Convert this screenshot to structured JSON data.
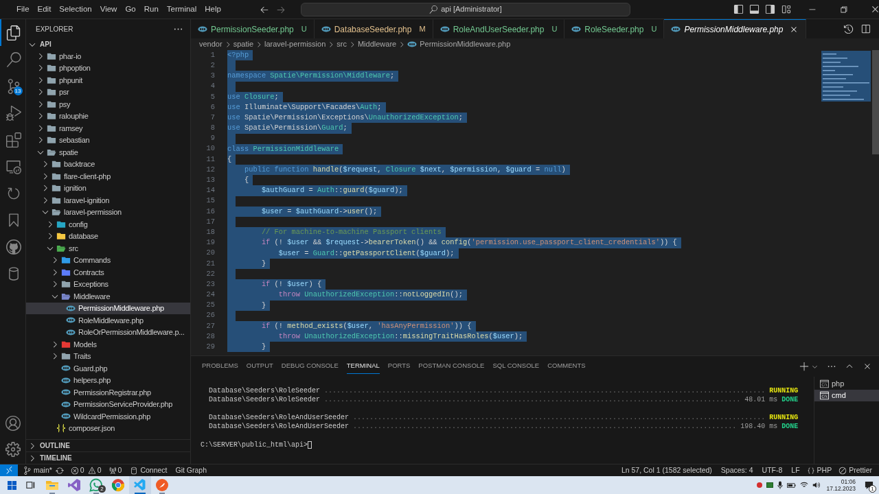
{
  "title_bar": {
    "menu": [
      "File",
      "Edit",
      "Selection",
      "View",
      "Go",
      "Run",
      "Terminal",
      "Help"
    ],
    "command_center": "api [Administrator]"
  },
  "activity_bar": {
    "items": [
      {
        "selected": true
      },
      {
        "selected": false
      },
      {
        "selected": false,
        "badge": "13"
      },
      {
        "selected": false
      },
      {
        "selected": false
      },
      {
        "selected": false
      },
      {
        "selected": false
      },
      {
        "selected": false
      },
      {
        "selected": false
      },
      {
        "selected": false
      }
    ]
  },
  "explorer": {
    "title": "EXPLORER",
    "section": {
      "label": "API",
      "expanded": true
    },
    "tree": [
      {
        "label": "phar-io",
        "kind": "folder",
        "expanded": false,
        "selected": false,
        "color": "#90a4ae"
      },
      {
        "label": "phpoption",
        "kind": "folder",
        "expanded": false,
        "selected": false,
        "color": "#90a4ae"
      },
      {
        "label": "phpunit",
        "kind": "folder",
        "expanded": false,
        "selected": false,
        "color": "#90a4ae"
      },
      {
        "label": "psr",
        "kind": "folder",
        "expanded": false,
        "selected": false,
        "color": "#90a4ae"
      },
      {
        "label": "psy",
        "kind": "folder",
        "expanded": false,
        "selected": false,
        "color": "#90a4ae"
      },
      {
        "label": "ralouphie",
        "kind": "folder",
        "expanded": false,
        "selected": false,
        "color": "#90a4ae"
      },
      {
        "label": "ramsey",
        "kind": "folder",
        "expanded": false,
        "selected": false,
        "color": "#90a4ae"
      },
      {
        "label": "sebastian",
        "kind": "folder",
        "expanded": false,
        "selected": false,
        "color": "#90a4ae"
      },
      {
        "label": "spatie",
        "kind": "folder",
        "expanded": true,
        "selected": false,
        "color": "#90a4ae",
        "children": [
          {
            "label": "backtrace",
            "kind": "folder",
            "expanded": false,
            "selected": false,
            "color": "#90a4ae"
          },
          {
            "label": "flare-client-php",
            "kind": "folder",
            "expanded": false,
            "selected": false,
            "color": "#90a4ae"
          },
          {
            "label": "ignition",
            "kind": "folder",
            "expanded": false,
            "selected": false,
            "color": "#90a4ae"
          },
          {
            "label": "laravel-ignition",
            "kind": "folder",
            "expanded": false,
            "selected": false,
            "color": "#90a4ae"
          },
          {
            "label": "laravel-permission",
            "kind": "folder",
            "expanded": true,
            "selected": false,
            "color": "#90a4ae",
            "children": [
              {
                "label": "config",
                "kind": "folder",
                "expanded": false,
                "selected": false,
                "color": "#26a6c4"
              },
              {
                "label": "database",
                "kind": "folder",
                "expanded": false,
                "selected": false,
                "color": "#f5c842"
              },
              {
                "label": "src",
                "kind": "folder",
                "expanded": true,
                "selected": false,
                "color": "#4caf50",
                "children": [
                  {
                    "label": "Commands",
                    "kind": "folder",
                    "expanded": false,
                    "selected": false,
                    "color": "#2f9be8"
                  },
                  {
                    "label": "Contracts",
                    "kind": "folder",
                    "expanded": false,
                    "selected": false,
                    "color": "#5c7cfa"
                  },
                  {
                    "label": "Exceptions",
                    "kind": "folder",
                    "expanded": false,
                    "selected": false,
                    "color": "#90a4ae"
                  },
                  {
                    "label": "Middleware",
                    "kind": "folder",
                    "expanded": true,
                    "selected": false,
                    "color": "#7986cb",
                    "children": [
                      {
                        "label": "PermissionMiddleware.php",
                        "kind": "file",
                        "selected": true,
                        "color": "#519aba"
                      },
                      {
                        "label": "RoleMiddleware.php",
                        "kind": "file",
                        "selected": false,
                        "color": "#519aba"
                      },
                      {
                        "label": "RoleOrPermissionMiddleware.p...",
                        "kind": "file",
                        "selected": false,
                        "color": "#519aba"
                      }
                    ]
                  },
                  {
                    "label": "Models",
                    "kind": "folder",
                    "expanded": false,
                    "selected": false,
                    "color": "#e53935"
                  },
                  {
                    "label": "Traits",
                    "kind": "folder",
                    "expanded": false,
                    "selected": false,
                    "color": "#90a4ae"
                  },
                  {
                    "label": "Guard.php",
                    "kind": "file",
                    "selected": false,
                    "color": "#519aba"
                  },
                  {
                    "label": "helpers.php",
                    "kind": "file",
                    "selected": false,
                    "color": "#519aba"
                  },
                  {
                    "label": "PermissionRegistrar.php",
                    "kind": "file",
                    "selected": false,
                    "color": "#519aba"
                  },
                  {
                    "label": "PermissionServiceProvider.php",
                    "kind": "file",
                    "selected": false,
                    "color": "#519aba"
                  },
                  {
                    "label": "WildcardPermission.php",
                    "kind": "file",
                    "selected": false,
                    "color": "#519aba"
                  }
                ]
              },
              {
                "label": "composer.json",
                "kind": "json",
                "selected": false,
                "color": "#cbcb41"
              }
            ]
          }
        ]
      }
    ],
    "bottom_sections": [
      {
        "label": "OUTLINE",
        "expanded": false
      },
      {
        "label": "TIMELINE",
        "expanded": false
      }
    ]
  },
  "tabs": [
    {
      "label": "PermissionSeeder.php",
      "badge": "U",
      "color": "#73c991",
      "selected": false,
      "preview": false
    },
    {
      "label": "DatabaseSeeder.php",
      "badge": "M",
      "color": "#e2c08d",
      "selected": false,
      "preview": false
    },
    {
      "label": "RoleAndUserSeeder.php",
      "badge": "U",
      "color": "#73c991",
      "selected": false,
      "preview": false
    },
    {
      "label": "RoleSeeder.php",
      "badge": "U",
      "color": "#73c991",
      "selected": false,
      "preview": false
    },
    {
      "label": "PermissionMiddleware.php",
      "color": "#ffffff",
      "selected": true,
      "preview": true
    }
  ],
  "breadcrumb": [
    "vendor",
    "spatie",
    "laravel-permission",
    "src",
    "Middleware",
    "PermissionMiddleware.php"
  ],
  "editor": {
    "lines": [
      {
        "number": "1",
        "selected": true,
        "tokens": [
          {
            "kind": "tag",
            "text": "<?php"
          }
        ]
      },
      {
        "number": "2",
        "selected": true
      },
      {
        "number": "3",
        "selected": true,
        "tokens": [
          {
            "kind": "kw",
            "text": "namespace"
          },
          {
            "kind": "type",
            "text": " Spatie\\Permission\\Middleware"
          },
          {
            "kind": "plain",
            "text": ";"
          }
        ]
      },
      {
        "number": "4",
        "selected": true
      },
      {
        "number": "5",
        "selected": true,
        "tokens": [
          {
            "kind": "kw",
            "text": "use"
          },
          {
            "kind": "type",
            "text": " Closure"
          },
          {
            "kind": "plain",
            "text": ";"
          }
        ]
      },
      {
        "number": "6",
        "selected": true,
        "tokens": [
          {
            "kind": "kw",
            "text": "use"
          },
          {
            "kind": "plain",
            "text": " Illuminate\\Support\\Facades\\"
          },
          {
            "kind": "type",
            "text": "Auth"
          },
          {
            "kind": "plain",
            "text": ";"
          }
        ]
      },
      {
        "number": "7",
        "selected": true,
        "tokens": [
          {
            "kind": "kw",
            "text": "use"
          },
          {
            "kind": "plain",
            "text": " Spatie\\Permission\\Exceptions\\"
          },
          {
            "kind": "type",
            "text": "UnauthorizedException"
          },
          {
            "kind": "plain",
            "text": ";"
          }
        ]
      },
      {
        "number": "8",
        "selected": true,
        "tokens": [
          {
            "kind": "kw",
            "text": "use"
          },
          {
            "kind": "plain",
            "text": " Spatie\\Permission\\"
          },
          {
            "kind": "type",
            "text": "Guard"
          },
          {
            "kind": "plain",
            "text": ";"
          }
        ]
      },
      {
        "number": "9",
        "selected": true
      },
      {
        "number": "10",
        "selected": true,
        "tokens": [
          {
            "kind": "kw",
            "text": "class"
          },
          {
            "kind": "type",
            "text": " PermissionMiddleware"
          }
        ]
      },
      {
        "number": "11",
        "selected": true,
        "tokens": [
          {
            "kind": "plain",
            "text": "{"
          }
        ]
      },
      {
        "number": "12",
        "selected": true,
        "tokens": [
          {
            "kind": "kw",
            "text": "    public function"
          },
          {
            "kind": "fn",
            "text": " handle"
          },
          {
            "kind": "plain",
            "text": "("
          },
          {
            "kind": "var",
            "text": "$request"
          },
          {
            "kind": "plain",
            "text": ", "
          },
          {
            "kind": "type",
            "text": "Closure "
          },
          {
            "kind": "var",
            "text": "$next"
          },
          {
            "kind": "plain",
            "text": ", "
          },
          {
            "kind": "var",
            "text": "$permission"
          },
          {
            "kind": "plain",
            "text": ", "
          },
          {
            "kind": "var",
            "text": "$guard"
          },
          {
            "kind": "plain",
            "text": " = "
          },
          {
            "kind": "kw",
            "text": "null"
          },
          {
            "kind": "plain",
            "text": ")"
          }
        ]
      },
      {
        "number": "13",
        "selected": true,
        "tokens": [
          {
            "kind": "plain",
            "text": "    {"
          }
        ]
      },
      {
        "number": "14",
        "selected": true,
        "tokens": [
          {
            "kind": "var",
            "text": "        $authGuard"
          },
          {
            "kind": "plain",
            "text": " = "
          },
          {
            "kind": "type",
            "text": "Auth"
          },
          {
            "kind": "plain",
            "text": "::"
          },
          {
            "kind": "fn",
            "text": "guard"
          },
          {
            "kind": "plain",
            "text": "("
          },
          {
            "kind": "var",
            "text": "$guard"
          },
          {
            "kind": "plain",
            "text": ");"
          }
        ]
      },
      {
        "number": "15",
        "selected": true
      },
      {
        "number": "16",
        "selected": true,
        "tokens": [
          {
            "kind": "var",
            "text": "        $user"
          },
          {
            "kind": "plain",
            "text": " = "
          },
          {
            "kind": "var",
            "text": "$authGuard"
          },
          {
            "kind": "plain",
            "text": "->"
          },
          {
            "kind": "fn",
            "text": "user"
          },
          {
            "kind": "plain",
            "text": "();"
          }
        ]
      },
      {
        "number": "17",
        "selected": true
      },
      {
        "number": "18",
        "selected": true,
        "tokens": [
          {
            "kind": "cmt",
            "text": "        // For machine-to-machine Passport clients"
          }
        ]
      },
      {
        "number": "19",
        "selected": true,
        "tokens": [
          {
            "kind": "ctrl",
            "text": "        if"
          },
          {
            "kind": "plain",
            "text": " (! "
          },
          {
            "kind": "var",
            "text": "$user"
          },
          {
            "kind": "plain",
            "text": " && "
          },
          {
            "kind": "var",
            "text": "$request"
          },
          {
            "kind": "plain",
            "text": "->"
          },
          {
            "kind": "fn",
            "text": "bearerToken"
          },
          {
            "kind": "plain",
            "text": "() && "
          },
          {
            "kind": "fn",
            "text": "config"
          },
          {
            "kind": "plain",
            "text": "("
          },
          {
            "kind": "str",
            "text": "'permission.use_passport_client_credentials'"
          },
          {
            "kind": "plain",
            "text": ")) {"
          }
        ]
      },
      {
        "number": "20",
        "selected": true,
        "tokens": [
          {
            "kind": "var",
            "text": "            $user"
          },
          {
            "kind": "plain",
            "text": " = "
          },
          {
            "kind": "type",
            "text": "Guard"
          },
          {
            "kind": "plain",
            "text": "::"
          },
          {
            "kind": "fn",
            "text": "getPassportClient"
          },
          {
            "kind": "plain",
            "text": "("
          },
          {
            "kind": "var",
            "text": "$guard"
          },
          {
            "kind": "plain",
            "text": ");"
          }
        ]
      },
      {
        "number": "21",
        "selected": true,
        "tokens": [
          {
            "kind": "plain",
            "text": "        }"
          }
        ]
      },
      {
        "number": "22",
        "selected": true
      },
      {
        "number": "23",
        "selected": true,
        "tokens": [
          {
            "kind": "ctrl",
            "text": "        if"
          },
          {
            "kind": "plain",
            "text": " (! "
          },
          {
            "kind": "var",
            "text": "$user"
          },
          {
            "kind": "plain",
            "text": ") {"
          }
        ]
      },
      {
        "number": "24",
        "selected": true,
        "tokens": [
          {
            "kind": "ctrl",
            "text": "            throw"
          },
          {
            "kind": "type",
            "text": " UnauthorizedException"
          },
          {
            "kind": "plain",
            "text": "::"
          },
          {
            "kind": "fn",
            "text": "notLoggedIn"
          },
          {
            "kind": "plain",
            "text": "();"
          }
        ]
      },
      {
        "number": "25",
        "selected": true,
        "tokens": [
          {
            "kind": "plain",
            "text": "        }"
          }
        ]
      },
      {
        "number": "26",
        "selected": true
      },
      {
        "number": "27",
        "selected": true,
        "tokens": [
          {
            "kind": "ctrl",
            "text": "        if"
          },
          {
            "kind": "plain",
            "text": " (! "
          },
          {
            "kind": "fn",
            "text": "method_exists"
          },
          {
            "kind": "plain",
            "text": "("
          },
          {
            "kind": "var",
            "text": "$user"
          },
          {
            "kind": "plain",
            "text": ", "
          },
          {
            "kind": "str",
            "text": "'hasAnyPermission'"
          },
          {
            "kind": "plain",
            "text": ")) {"
          }
        ]
      },
      {
        "number": "28",
        "selected": true,
        "tokens": [
          {
            "kind": "ctrl",
            "text": "            throw"
          },
          {
            "kind": "type",
            "text": " UnauthorizedException"
          },
          {
            "kind": "plain",
            "text": "::"
          },
          {
            "kind": "fn",
            "text": "missingTraitHasRoles"
          },
          {
            "kind": "plain",
            "text": "("
          },
          {
            "kind": "var",
            "text": "$user"
          },
          {
            "kind": "plain",
            "text": ");"
          }
        ]
      },
      {
        "number": "29",
        "selected": true,
        "tokens": [
          {
            "kind": "plain",
            "text": "        }"
          }
        ]
      }
    ]
  },
  "panel": {
    "tabs": [
      {
        "label": "PROBLEMS",
        "selected": false
      },
      {
        "label": "OUTPUT",
        "selected": false
      },
      {
        "label": "DEBUG CONSOLE",
        "selected": false
      },
      {
        "label": "TERMINAL",
        "selected": true
      },
      {
        "label": "PORTS",
        "selected": false
      },
      {
        "label": "POSTMAN CONSOLE",
        "selected": false
      },
      {
        "label": "SQL CONSOLE",
        "selected": false
      },
      {
        "label": "COMMENTS",
        "selected": false
      }
    ],
    "terminal": {
      "blocks": [
        [
          {
            "name": "Database\\Seeders\\RoleSeeder",
            "leader": "...........................................................................................................",
            "status": "RUNNING",
            "kind": "running"
          },
          {
            "name": "Database\\Seeders\\RoleSeeder",
            "leader": ".....................................................................................................",
            "time": "48.01 ms",
            "status": "DONE",
            "kind": "done"
          }
        ],
        [
          {
            "name": "Database\\Seeders\\RoleAndUserSeeder",
            "leader": "....................................................................................................",
            "status": "RUNNING",
            "kind": "running"
          },
          {
            "name": "Database\\Seeders\\RoleAndUserSeeder",
            "leader": ".............................................................................................",
            "time": "198.40 ms",
            "status": "DONE",
            "kind": "done"
          }
        ]
      ],
      "prompt": "C:\\SERVER\\public_html\\api>"
    },
    "sessions": [
      {
        "label": "php",
        "selected": false
      },
      {
        "label": "cmd",
        "selected": true
      }
    ]
  },
  "status_bar": {
    "branch": "main*",
    "errors": "0",
    "warnings": "0",
    "ports": "0",
    "connect": "Connect",
    "git_graph": "Git Graph",
    "position": "Ln 57, Col 1 (1582 selected)",
    "spaces": "Spaces: 4",
    "encoding": "UTF-8",
    "eol": "LF",
    "language": "PHP",
    "formatter": "Prettier"
  },
  "taskbar": {
    "apps": [
      {
        "running": true,
        "selected": false
      },
      {
        "running": false,
        "selected": false
      },
      {
        "running": true,
        "selected": false,
        "badge": "2"
      },
      {
        "running": false,
        "selected": false
      },
      {
        "running": true,
        "selected": true
      },
      {
        "running": true,
        "selected": false
      }
    ],
    "time": "01:06",
    "date": "17.12.2023",
    "notifications": "1"
  }
}
